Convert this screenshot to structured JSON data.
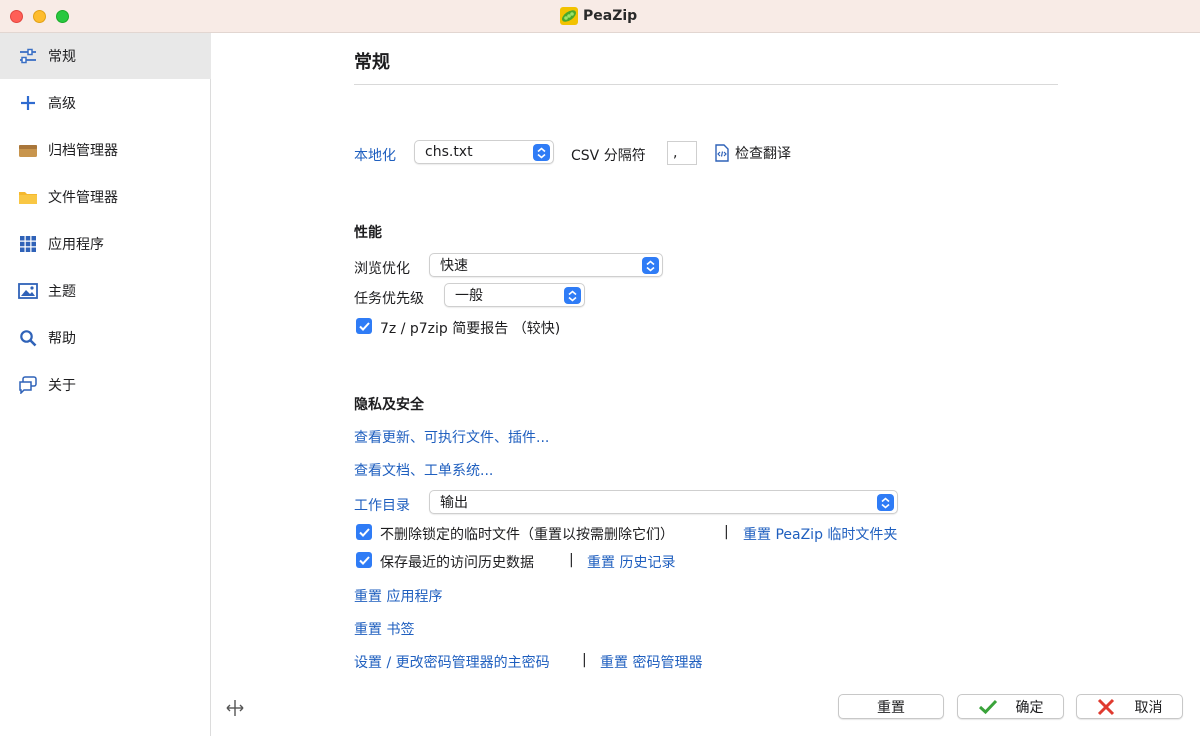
{
  "window": {
    "title": "PeaZip"
  },
  "sidebar": {
    "items": [
      {
        "label": "常规",
        "icon": "sliders-icon"
      },
      {
        "label": "高级",
        "icon": "plus-icon"
      },
      {
        "label": "归档管理器",
        "icon": "archive-box-icon"
      },
      {
        "label": "文件管理器",
        "icon": "folder-icon"
      },
      {
        "label": "应用程序",
        "icon": "grid-icon"
      },
      {
        "label": "主题",
        "icon": "image-icon"
      },
      {
        "label": "帮助",
        "icon": "magnifier-icon"
      },
      {
        "label": "关于",
        "icon": "chat-bubbles-icon"
      }
    ]
  },
  "main": {
    "heading": "常规",
    "localization": {
      "label": "本地化",
      "language_value": "chs.txt",
      "csv_label": "CSV 分隔符",
      "csv_value": ",",
      "check_translation": "检查翻译"
    },
    "performance": {
      "title": "性能",
      "browse_label": "浏览优化",
      "browse_value": "快速",
      "priority_label": "任务优先级",
      "priority_value": "一般",
      "brief_report_label": "7z / p7zip 简要报告 （较快)"
    },
    "privacy": {
      "title": "隐私及安全",
      "check_updates": "查看更新、可执行文件、插件...",
      "check_docs": "查看文档、工单系统...",
      "workdir_label": "工作目录",
      "workdir_value": "输出",
      "keep_locked_label": "不删除锁定的临时文件（重置以按需删除它们）",
      "reset_temp": "重置 PeaZip 临时文件夹",
      "save_history_label": "保存最近的访问历史数据",
      "reset_history": "重置 历史记录",
      "reset_apps": "重置 应用程序",
      "reset_bookmarks": "重置 书签",
      "set_master_pw": "设置 / 更改密码管理器的主密码",
      "reset_pw_manager": "重置 密码管理器",
      "separator": "|"
    }
  },
  "footer": {
    "reset": "重置",
    "ok": "确定",
    "cancel": "取消"
  },
  "colors": {
    "accent": "#2f7cf6",
    "link": "#1f5fbf",
    "titlebar": "#f8ebe6",
    "ok_green": "#3aa33a",
    "cancel_red": "#e03a2f"
  }
}
